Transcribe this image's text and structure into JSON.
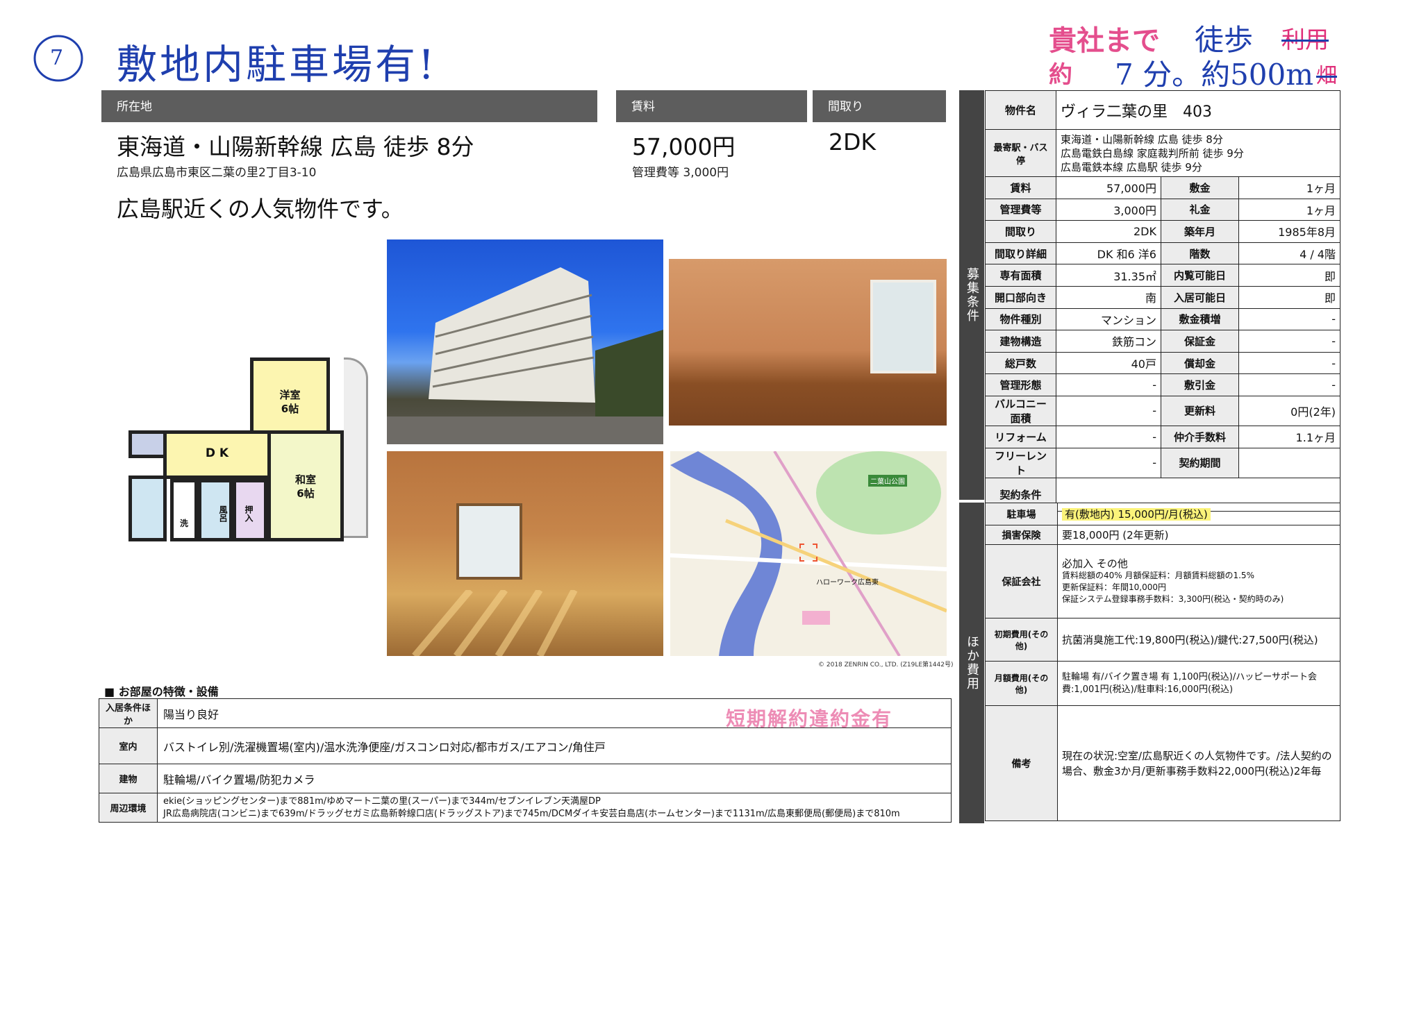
{
  "handwriting": {
    "circle_number": "7",
    "note": "敷地内駐車場有!"
  },
  "stamp_top_right": {
    "line1_printed": "貴社まで",
    "line1_hw": "徒歩",
    "line1_strike": "利用",
    "line2_printed": "約",
    "line2_hw": "7 分。約500m",
    "line2_strike": "畑"
  },
  "headers": {
    "location": "所在地",
    "rent": "賃料",
    "layout": "間取り"
  },
  "summary": {
    "station": "東海道・山陽新幹線 広島 徒歩 8分",
    "address": "広島県広島市東区二葉の里2丁目3-10",
    "rent": "57,000円",
    "mgmt": "管理費等 3,000円",
    "layout": "2DK",
    "catch": "広島駅近くの人気物件です。"
  },
  "floorplan": {
    "room1_name": "洋室",
    "room1_size": "6帖",
    "room2_name": "和室",
    "room2_size": "6帖",
    "dk": "D K",
    "bath": "風呂",
    "wash": "洗",
    "closet": "押入"
  },
  "map": {
    "credit": "© 2018 ZENRIN CO., LTD. (Z19LE第1442号)",
    "label_station": "二葉山公園",
    "label_hellowork": "ハローワーク広島東"
  },
  "features": {
    "title": "■ お部屋の特徴・設備",
    "watermark": "短期解約違約金有",
    "rows": [
      {
        "label": "入居条件ほか",
        "value": "陽当り良好"
      },
      {
        "label": "室内",
        "value": "バストイレ別/洗濯機置場(室内)/温水洗浄便座/ガスコンロ対応/都市ガス/エアコン/角住戸"
      },
      {
        "label": "建物",
        "value": "駐輪場/バイク置場/防犯カメラ"
      },
      {
        "label": "周辺環境",
        "value": "ekie(ショッピングセンター)まで881m/ゆめマート二葉の里(スーパー)まで344m/セブンイレブン天満屋DP",
        "value2": "JR広島病院店(コンビニ)まで639m/ドラッグセガミ広島新幹線口店(ドラッグストア)まで745m/DCMダイキ安芸白島店(ホームセンター)まで1131m/広島東郵便局(郵便局)まで810m"
      }
    ]
  },
  "spec": {
    "side_label": "募集条件",
    "name_label": "物件名",
    "name": "ヴィラ二葉の里　403",
    "station_label": "最寄駅・バス停",
    "stations": [
      "東海道・山陽新幹線 広島 徒歩 8分",
      "広島電鉄白島線 家庭裁判所前 徒歩 9分",
      "広島電鉄本線 広島駅 徒歩 9分"
    ],
    "rows": [
      [
        "賃料",
        "57,000円",
        "敷金",
        "1ヶ月"
      ],
      [
        "管理費等",
        "3,000円",
        "礼金",
        "1ヶ月"
      ],
      [
        "間取り",
        "2DK",
        "築年月",
        "1985年8月"
      ],
      [
        "間取り詳細",
        "DK 和6 洋6",
        "階数",
        "4 / 4階"
      ],
      [
        "専有面積",
        "31.35㎡",
        "内覧可能日",
        "即"
      ],
      [
        "開口部向き",
        "南",
        "入居可能日",
        "即"
      ],
      [
        "物件種別",
        "マンション",
        "敷金積増",
        "-"
      ],
      [
        "建物構造",
        "鉄筋コン",
        "保証金",
        "-"
      ],
      [
        "総戸数",
        "40戸",
        "償却金",
        "-"
      ],
      [
        "管理形態",
        "-",
        "敷引金",
        "-"
      ],
      [
        "バルコニー面積",
        "-",
        "更新料",
        "0円(2年)"
      ],
      [
        "リフォーム",
        "-",
        "仲介手数料",
        "1.1ヶ月"
      ],
      [
        "フリーレント",
        "-",
        "契約期間",
        ""
      ]
    ],
    "contract_label": "契約条件",
    "contract": ""
  },
  "other": {
    "side_label": "ほか費用",
    "rows": [
      {
        "label": "駐車場",
        "value": "有(敷地内) 15,000円/月(税込)"
      },
      {
        "label": "損害保険",
        "value": "要18,000円 (2年更新)"
      },
      {
        "label": "保証会社",
        "lines": [
          "必加入 その他",
          "賃料総額の40% 月額保証料：月額賃料総額の1.5%",
          "更新保証料：年間10,000円",
          "保証システム登録事務手数料：3,300円(税込・契約時のみ)"
        ]
      },
      {
        "label": "初期費用(その他)",
        "value": "抗菌消臭施工代:19,800円(税込)/鍵代:27,500円(税込)"
      },
      {
        "label": "月額費用(その他)",
        "value": "駐輪場 有/バイク置き場 有 1,100円(税込)/ハッピーサポート会費:1,001円(税込)/駐車料:16,000円(税込)"
      },
      {
        "label": "備考",
        "value": "現在の状況:空室/広島駅近くの人気物件です。/法人契約の場合、敷金3か月/更新事務手数料22,000円(税込)2年毎"
      }
    ]
  }
}
